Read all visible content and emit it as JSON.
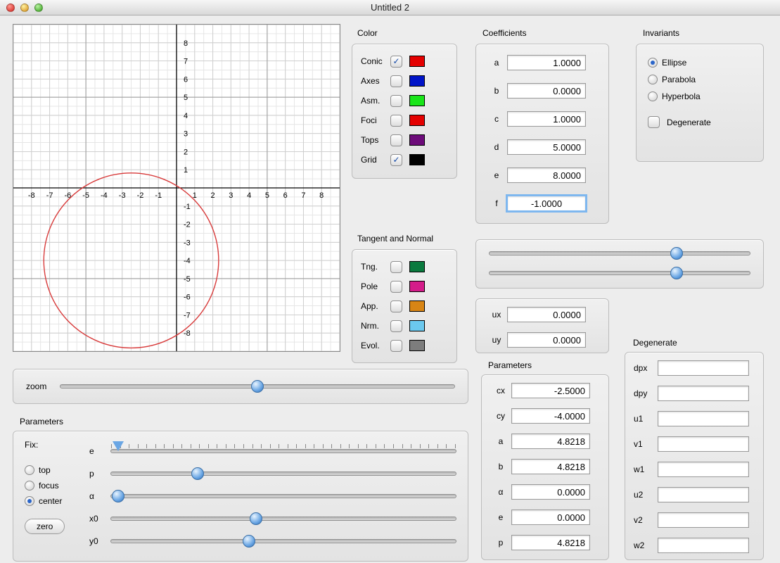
{
  "window": {
    "title": "Untitled 2"
  },
  "color": {
    "heading": "Color",
    "items": [
      {
        "label": "Conic",
        "checked": true,
        "swatch": "#e40000"
      },
      {
        "label": "Axes",
        "checked": false,
        "swatch": "#0014c8"
      },
      {
        "label": "Asm.",
        "checked": false,
        "swatch": "#19e519"
      },
      {
        "label": "Foci",
        "checked": false,
        "swatch": "#e40000"
      },
      {
        "label": "Tops",
        "checked": false,
        "swatch": "#6d0b7a"
      },
      {
        "label": "Grid",
        "checked": true,
        "swatch": "#000000"
      }
    ]
  },
  "tangent": {
    "heading": "Tangent and Normal",
    "items": [
      {
        "label": "Tng.",
        "checked": false,
        "swatch": "#0a7a3e"
      },
      {
        "label": "Pole",
        "checked": false,
        "swatch": "#d41c8a"
      },
      {
        "label": "App.",
        "checked": false,
        "swatch": "#d88514"
      },
      {
        "label": "Nrm.",
        "checked": false,
        "swatch": "#6bc8ee"
      },
      {
        "label": "Evol.",
        "checked": false,
        "swatch": "#7d7d7d"
      }
    ]
  },
  "coefficients": {
    "heading": "Coefficients",
    "a": "1.0000",
    "b": "0.0000",
    "c": "1.0000",
    "d": "5.0000",
    "e": "8.0000",
    "f": "-1.0000",
    "f_focused": true
  },
  "u": {
    "ux": "0.0000",
    "uy": "0.0000"
  },
  "invariants": {
    "heading": "Invariants",
    "options": [
      "Ellipse",
      "Parabola",
      "Hyperbola"
    ],
    "selected": "Ellipse",
    "degenerate_label": "Degenerate",
    "degenerate_checked": false
  },
  "parameters_right": {
    "heading": "Parameters",
    "cx": "-2.5000",
    "cy": "-4.0000",
    "a": "4.8218",
    "b": "4.8218",
    "alpha": "0.0000",
    "e": "0.0000",
    "p": "4.8218"
  },
  "degenerate": {
    "heading": "Degenerate",
    "fields": [
      "dpx",
      "dpy",
      "u1",
      "v1",
      "w1",
      "u2",
      "v2",
      "w2"
    ]
  },
  "zoom": {
    "label": "zoom",
    "pos": 0.5
  },
  "coef_sliders": {
    "s1": 0.72,
    "s2": 0.72
  },
  "parameters_left": {
    "heading": "Parameters",
    "fix_label": "Fix:",
    "fix_options": [
      "top",
      "focus",
      "center"
    ],
    "fix_selected": "center",
    "sliders": [
      {
        "label": "e",
        "pos": 0.02,
        "style": "tri",
        "ticks": true
      },
      {
        "label": "p",
        "pos": 0.25
      },
      {
        "label": "α",
        "pos": 0.02
      },
      {
        "label": "x0",
        "pos": 0.42
      },
      {
        "label": "y0",
        "pos": 0.4
      }
    ],
    "zero_label": "zero"
  },
  "chart_data": {
    "type": "scatter",
    "title": "",
    "xlabel": "",
    "ylabel": "",
    "xlim": [
      -9,
      9
    ],
    "ylim": [
      -9,
      9
    ],
    "x_ticks": [
      -8,
      -7,
      -6,
      -5,
      -4,
      -3,
      -2,
      -1,
      1,
      2,
      3,
      4,
      5,
      6,
      7,
      8
    ],
    "y_ticks": [
      -8,
      -7,
      -6,
      -5,
      -4,
      -3,
      -2,
      -1,
      1,
      2,
      3,
      4,
      5,
      6,
      7,
      8
    ],
    "grid": true,
    "grid_minor": true,
    "series": [
      {
        "name": "Conic (circle)",
        "type": "ellipse",
        "cx": -2.5,
        "cy": -4.0,
        "rx": 4.8218,
        "ry": 4.8218,
        "color": "#d83a3a"
      }
    ]
  }
}
